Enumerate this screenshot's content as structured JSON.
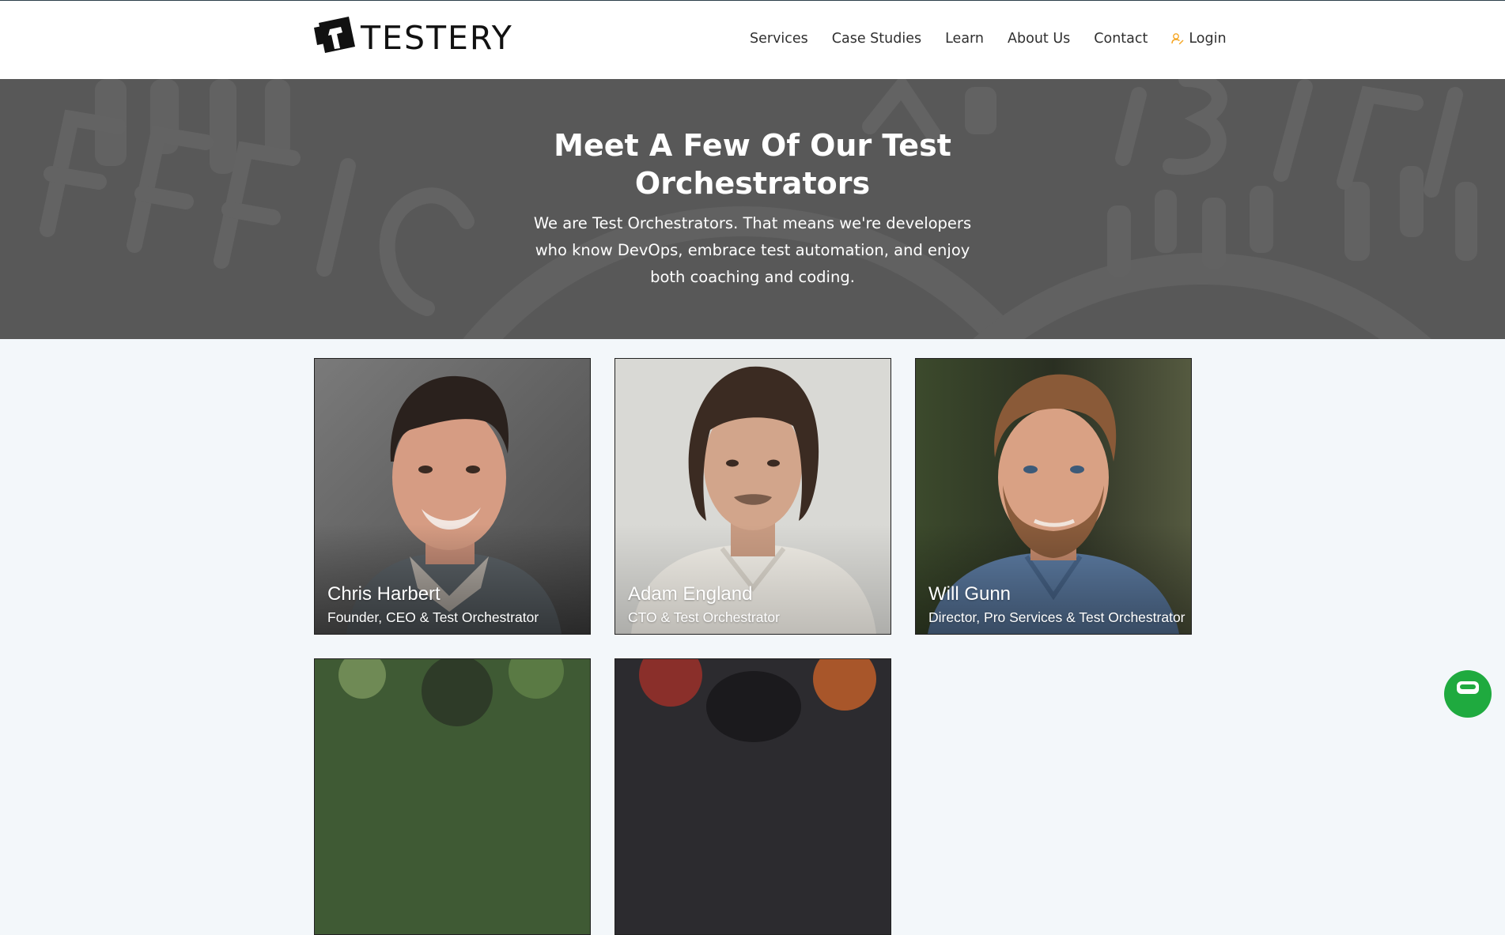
{
  "brand": {
    "name": "TESTERY",
    "logo_icon": "testery-logo-icon"
  },
  "nav": {
    "items": [
      {
        "label": "Services"
      },
      {
        "label": "Case Studies"
      },
      {
        "label": "Learn"
      },
      {
        "label": "About Us"
      },
      {
        "label": "Contact"
      }
    ],
    "login": {
      "label": "Login",
      "icon": "user-login-icon"
    }
  },
  "hero": {
    "title_line1": "Meet A Few Of Our Test",
    "title_line2": "Orchestrators",
    "subtitle": "We are Test Orchestrators. That means we're developers who know DevOps, embrace test automation, and enjoy both coaching and coding.",
    "background_words": [
      "EFFIC",
      "ABILIT"
    ]
  },
  "team": [
    {
      "name": "Chris Harbert",
      "role": "Founder, CEO & Test Orchestrator"
    },
    {
      "name": "Adam England",
      "role": "CTO & Test Orchestrator"
    },
    {
      "name": "Will Gunn",
      "role": "Director, Pro Services & Test Orchestrator"
    },
    {
      "name": "",
      "role": ""
    },
    {
      "name": "",
      "role": ""
    }
  ],
  "chat": {
    "icon": "chat-bubble-icon"
  },
  "colors": {
    "accent": "#f5a623",
    "hero_bg": "#585858",
    "page_bg": "#f3f7fa",
    "chat": "#1faa3f"
  }
}
